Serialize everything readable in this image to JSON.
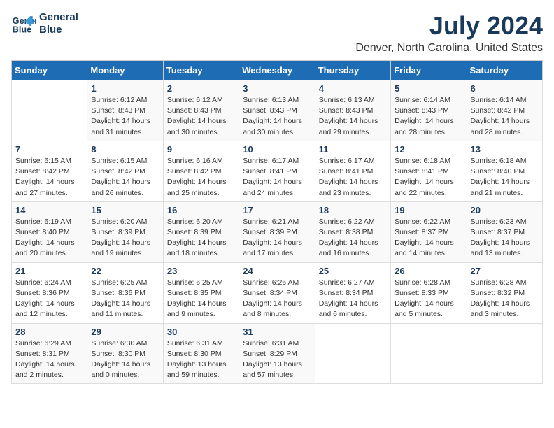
{
  "header": {
    "logo_line1": "General",
    "logo_line2": "Blue",
    "month_year": "July 2024",
    "location": "Denver, North Carolina, United States"
  },
  "weekdays": [
    "Sunday",
    "Monday",
    "Tuesday",
    "Wednesday",
    "Thursday",
    "Friday",
    "Saturday"
  ],
  "weeks": [
    [
      {
        "day": "",
        "info": ""
      },
      {
        "day": "1",
        "info": "Sunrise: 6:12 AM\nSunset: 8:43 PM\nDaylight: 14 hours\nand 31 minutes."
      },
      {
        "day": "2",
        "info": "Sunrise: 6:12 AM\nSunset: 8:43 PM\nDaylight: 14 hours\nand 30 minutes."
      },
      {
        "day": "3",
        "info": "Sunrise: 6:13 AM\nSunset: 8:43 PM\nDaylight: 14 hours\nand 30 minutes."
      },
      {
        "day": "4",
        "info": "Sunrise: 6:13 AM\nSunset: 8:43 PM\nDaylight: 14 hours\nand 29 minutes."
      },
      {
        "day": "5",
        "info": "Sunrise: 6:14 AM\nSunset: 8:43 PM\nDaylight: 14 hours\nand 28 minutes."
      },
      {
        "day": "6",
        "info": "Sunrise: 6:14 AM\nSunset: 8:42 PM\nDaylight: 14 hours\nand 28 minutes."
      }
    ],
    [
      {
        "day": "7",
        "info": ""
      },
      {
        "day": "8",
        "info": "Sunrise: 6:15 AM\nSunset: 8:42 PM\nDaylight: 14 hours\nand 26 minutes."
      },
      {
        "day": "9",
        "info": "Sunrise: 6:16 AM\nSunset: 8:42 PM\nDaylight: 14 hours\nand 25 minutes."
      },
      {
        "day": "10",
        "info": "Sunrise: 6:17 AM\nSunset: 8:41 PM\nDaylight: 14 hours\nand 24 minutes."
      },
      {
        "day": "11",
        "info": "Sunrise: 6:17 AM\nSunset: 8:41 PM\nDaylight: 14 hours\nand 23 minutes."
      },
      {
        "day": "12",
        "info": "Sunrise: 6:18 AM\nSunset: 8:41 PM\nDaylight: 14 hours\nand 22 minutes."
      },
      {
        "day": "13",
        "info": "Sunrise: 6:18 AM\nSunset: 8:40 PM\nDaylight: 14 hours\nand 21 minutes."
      }
    ],
    [
      {
        "day": "14",
        "info": ""
      },
      {
        "day": "15",
        "info": "Sunrise: 6:20 AM\nSunset: 8:39 PM\nDaylight: 14 hours\nand 19 minutes."
      },
      {
        "day": "16",
        "info": "Sunrise: 6:20 AM\nSunset: 8:39 PM\nDaylight: 14 hours\nand 18 minutes."
      },
      {
        "day": "17",
        "info": "Sunrise: 6:21 AM\nSunset: 8:39 PM\nDaylight: 14 hours\nand 17 minutes."
      },
      {
        "day": "18",
        "info": "Sunrise: 6:22 AM\nSunset: 8:38 PM\nDaylight: 14 hours\nand 16 minutes."
      },
      {
        "day": "19",
        "info": "Sunrise: 6:22 AM\nSunset: 8:37 PM\nDaylight: 14 hours\nand 14 minutes."
      },
      {
        "day": "20",
        "info": "Sunrise: 6:23 AM\nSunset: 8:37 PM\nDaylight: 14 hours\nand 13 minutes."
      }
    ],
    [
      {
        "day": "21",
        "info": ""
      },
      {
        "day": "22",
        "info": "Sunrise: 6:25 AM\nSunset: 8:36 PM\nDaylight: 14 hours\nand 11 minutes."
      },
      {
        "day": "23",
        "info": "Sunrise: 6:25 AM\nSunset: 8:35 PM\nDaylight: 14 hours\nand 9 minutes."
      },
      {
        "day": "24",
        "info": "Sunrise: 6:26 AM\nSunset: 8:34 PM\nDaylight: 14 hours\nand 8 minutes."
      },
      {
        "day": "25",
        "info": "Sunrise: 6:27 AM\nSunset: 8:34 PM\nDaylight: 14 hours\nand 6 minutes."
      },
      {
        "day": "26",
        "info": "Sunrise: 6:28 AM\nSunset: 8:33 PM\nDaylight: 14 hours\nand 5 minutes."
      },
      {
        "day": "27",
        "info": "Sunrise: 6:28 AM\nSunset: 8:32 PM\nDaylight: 14 hours\nand 3 minutes."
      }
    ],
    [
      {
        "day": "28",
        "info": "Sunrise: 6:29 AM\nSunset: 8:31 PM\nDaylight: 14 hours\nand 2 minutes."
      },
      {
        "day": "29",
        "info": "Sunrise: 6:30 AM\nSunset: 8:30 PM\nDaylight: 14 hours\nand 0 minutes."
      },
      {
        "day": "30",
        "info": "Sunrise: 6:31 AM\nSunset: 8:30 PM\nDaylight: 13 hours\nand 59 minutes."
      },
      {
        "day": "31",
        "info": "Sunrise: 6:31 AM\nSunset: 8:29 PM\nDaylight: 13 hours\nand 57 minutes."
      },
      {
        "day": "",
        "info": ""
      },
      {
        "day": "",
        "info": ""
      },
      {
        "day": "",
        "info": ""
      }
    ]
  ],
  "week1_sunday_info": "Sunrise: 6:15 AM\nSunset: 8:42 PM\nDaylight: 14 hours\nand 27 minutes.",
  "week3_sunday_info": "Sunrise: 6:19 AM\nSunset: 8:40 PM\nDaylight: 14 hours\nand 20 minutes.",
  "week4_sunday_info": "Sunrise: 6:24 AM\nSunset: 8:36 PM\nDaylight: 14 hours\nand 12 minutes."
}
